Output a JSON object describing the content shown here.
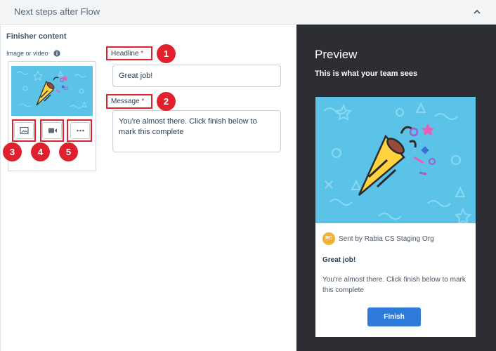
{
  "header": {
    "title": "Next steps after Flow"
  },
  "form": {
    "section_title": "Finisher content",
    "image_label": "Image or video",
    "headline_label": "Headline",
    "headline_value": "Great job!",
    "message_label": "Message",
    "message_value": "You're almost there. Click finish below to mark this complete",
    "required_mark": "*",
    "media_tools": [
      "image-icon",
      "video-icon",
      "more-icon"
    ]
  },
  "callouts": [
    "1",
    "2",
    "3",
    "4",
    "5"
  ],
  "preview": {
    "title": "Preview",
    "subtitle": "This is what your team sees",
    "avatar_initials": "RC",
    "sender": "Sent by Rabia CS Staging Org",
    "headline": "Great job!",
    "message": "You're almost there. Click finish below to mark this complete",
    "button_label": "Finish"
  },
  "colors": {
    "accent": "#2f7bd9",
    "callout": "#e0212d",
    "panel": "#2c2e33",
    "thumb": "#5bc3e8",
    "avatar": "#f2b134"
  }
}
